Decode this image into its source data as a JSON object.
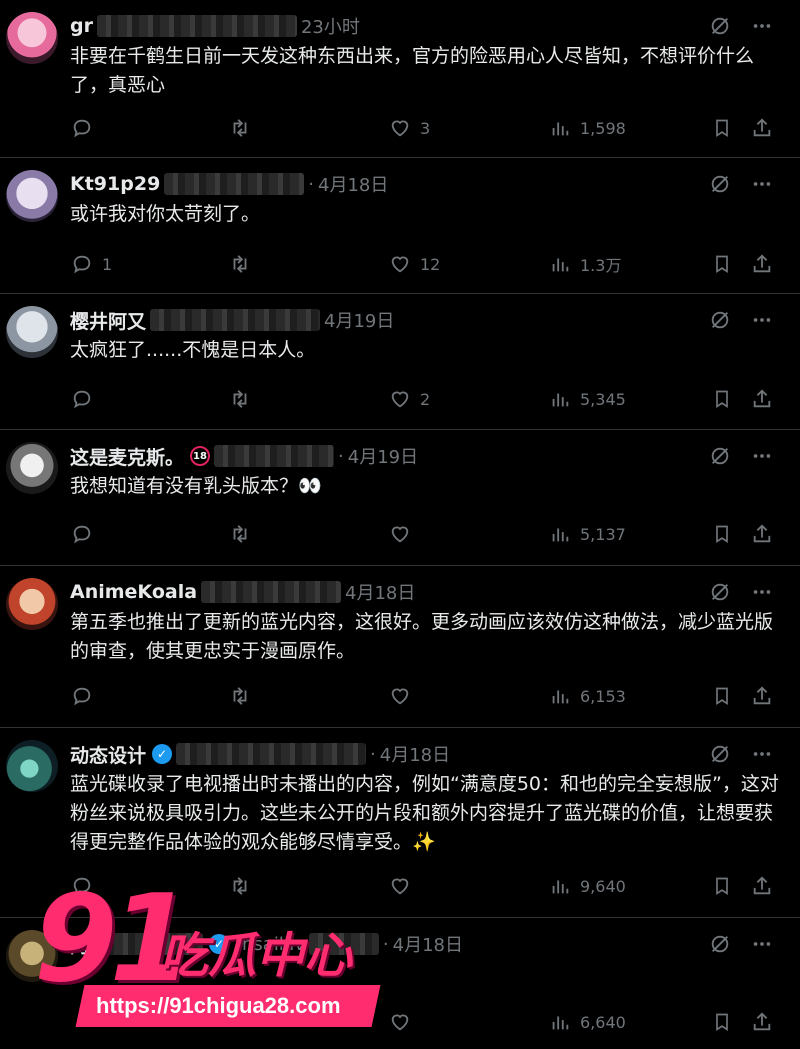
{
  "tweets": [
    {
      "name": "gr",
      "badge": "",
      "time": "23小时",
      "text": "非要在千鹤生日前一天发这种东西出来，官方的险恶用心人尽皆知，不想评价什么了，真恶心",
      "replies": "",
      "retweets": "",
      "likes": "3",
      "views": "1,598"
    },
    {
      "name": "Kt91p29",
      "badge": "",
      "time": "4月18日",
      "text": "或许我对你太苛刻了。",
      "replies": "1",
      "retweets": "",
      "likes": "12",
      "views": "1.3万"
    },
    {
      "name": "樱井阿又",
      "badge": "",
      "time": "4月19日",
      "text": "太疯狂了......不愧是日本人。",
      "replies": "",
      "retweets": "",
      "likes": "2",
      "views": "5,345"
    },
    {
      "name": "这是麦克斯。",
      "badge": "18",
      "time": "4月19日",
      "text": "我想知道有没有乳头版本？👀",
      "replies": "",
      "retweets": "",
      "likes": "",
      "views": "5,137"
    },
    {
      "name": "AnimeKoala",
      "badge": "",
      "time": "4月18日",
      "text": "第五季也推出了更新的蓝光内容，这很好。更多动画应该效仿这种做法，减少蓝光版的审查，使其更忠实于漫画原作。",
      "replies": "",
      "retweets": "",
      "likes": "",
      "views": "6,153"
    },
    {
      "name": "动态设计",
      "badge": "verified",
      "time": "4月18日",
      "text": "蓝光碟收录了电视播出时未播出的内容，例如“满意度50：和也的完全妄想版”，这对粉丝来说极具吸引力。这些未公开的片段和额外内容提升了蓝光碟的价值，让想要获得更完整作品体验的观众能够尽情享受。✨",
      "replies": "",
      "retweets": "",
      "likes": "",
      "views": "9,640"
    },
    {
      "name": "阿",
      "badge": "verified",
      "handle": "insaikiv",
      "time": "4月18日",
      "text": "",
      "replies": "",
      "retweets": "",
      "likes": "",
      "views": "6,640"
    }
  ],
  "watermark": {
    "number": "91",
    "name": "吃瓜中心",
    "url": "https://91chigua28.com"
  },
  "colors": {
    "background": "#000000",
    "text": "#e7e9ea",
    "muted": "#71767b",
    "accent": "#1d9bf0",
    "watermark": "#ff2d6f"
  }
}
